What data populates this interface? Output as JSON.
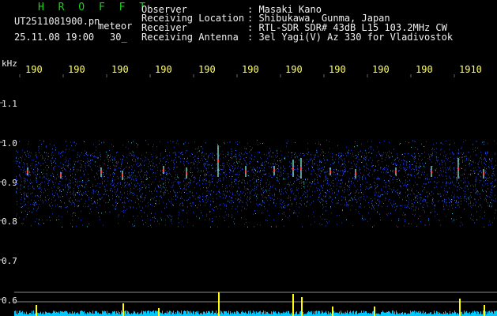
{
  "header": {
    "title": "H R O F F T",
    "filename": "UT2511081900.pn",
    "meteor_label": "meteor",
    "datetime": "25.11.08 19:00",
    "count": "30_",
    "rows": [
      {
        "label": "Observer",
        "value": ": Masaki Kano"
      },
      {
        "label": "Receiving Location",
        "value": ": Shibukawa, Gunma, Japan"
      },
      {
        "label": "Receiver",
        "value": ": RTL-SDR SDR# 43dB L15 103.2MHz CW"
      },
      {
        "label": "Receiving Antenna",
        "value": ": 3el Yagi(V) Az 330 for Vladivostok"
      }
    ]
  },
  "y_axis": {
    "unit": "kHz",
    "ticks": [
      "1.1",
      "1.0",
      "0.9",
      "0.8",
      "0.7",
      "0.6"
    ]
  },
  "time_labels": [
    "190",
    "190",
    "190",
    "190",
    "190",
    "190",
    "190",
    "190",
    "190",
    "190",
    "1910"
  ],
  "colors": {
    "background": "#000000",
    "text": "#f0f0f0",
    "title": "#19d319",
    "time_label": "#ffff66",
    "noise": "#1e33c8",
    "baseline": "#00c8ff",
    "meteor_spike": "#ffff00"
  }
}
